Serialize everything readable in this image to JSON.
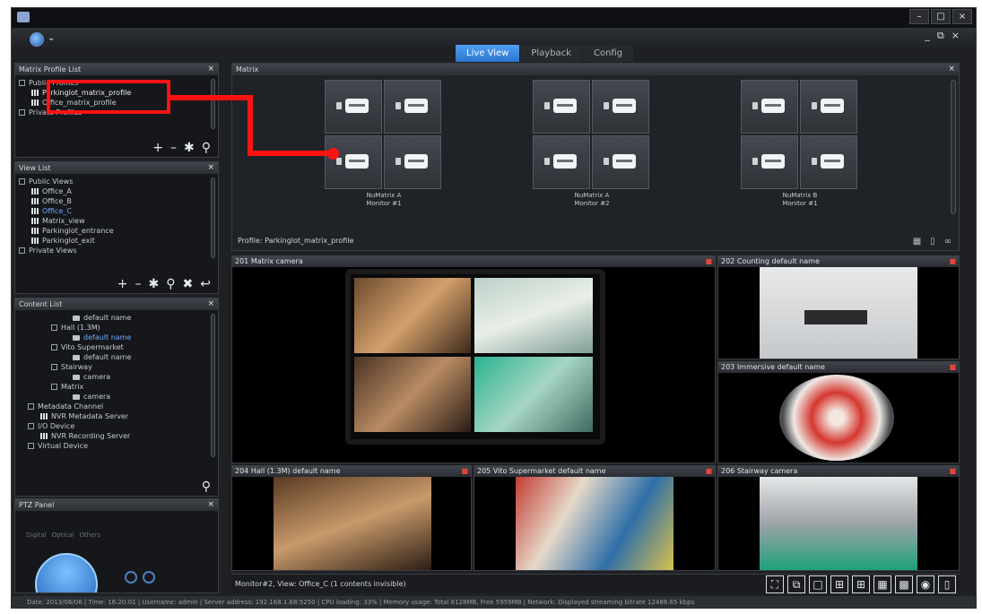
{
  "tabs": [
    {
      "label": "Live View",
      "active": true
    },
    {
      "label": "Playback",
      "active": false
    },
    {
      "label": "Config",
      "active": false
    }
  ],
  "matrix_profile_panel": {
    "title": "Matrix Profile List",
    "items": [
      "Public Profiles",
      "Parkinglot_matrix_profile",
      "Office_matrix_profile",
      "Private Profiles"
    ]
  },
  "view_panel": {
    "title": "View List",
    "items": [
      "Public Views",
      "Office_A",
      "Office_B",
      "Office_C",
      "Matrix_view",
      "Parkinglot_entrance",
      "Parkinglot_exit",
      "Private Views"
    ]
  },
  "content_panel": {
    "title": "Content List",
    "items": [
      "default name",
      "Hall (1.3M)",
      "default name",
      "Vito Supermarket",
      "default name",
      "Stairway",
      "camera",
      "Matrix",
      "camera",
      "Metadata Channel",
      "NVR Metadata Server",
      "I/O Device",
      "NVR Recording Server",
      "Virtual Device"
    ]
  },
  "ptz_panel": {
    "title": "PTZ Panel",
    "tabs": [
      "Digital",
      "Optical",
      "Others"
    ]
  },
  "matrix": {
    "title": "Matrix",
    "groups": [
      {
        "line1": "NuMatrix A",
        "line2": "Monitor #1"
      },
      {
        "line1": "NuMatrix A",
        "line2": "Monitor #2"
      },
      {
        "line1": "NuMatrix B",
        "line2": "Monitor #1"
      }
    ],
    "profile_label": "Profile: Parkinglot_matrix_profile"
  },
  "tiles": [
    {
      "title": "201 Matrix camera"
    },
    {
      "title": "202 Counting default name"
    },
    {
      "title": "203 Immersive default name"
    },
    {
      "title": "204 Hall (1.3M) default name"
    },
    {
      "title": "205 Vito Supermarket default name"
    },
    {
      "title": "206 Stairway camera"
    }
  ],
  "status": {
    "monitor_text": "Monitor#2, View: Office_C (1 contents invisible)",
    "footer": "Date: 2013/06/06 | Time: 16:20:01 | Username: admin | Server address: 192.168.1.68:5250 | CPU loading: 33% | Memory usage: Total 8128MB, Free 5959MB | Network: Displayed streaming bitrate 12486.65 kbps"
  },
  "colors": {
    "highlight": "#ff1212",
    "tab_active": "#3a8ae6",
    "background": "#1e2024"
  },
  "icons": [
    "app-globe-icon",
    "add-icon",
    "remove-icon",
    "settings-icon",
    "search-icon",
    "tools-icon",
    "export-icon",
    "record-indicator-icon",
    "fullscreen-icon",
    "layout-1x1-icon",
    "layout-2x2-icon",
    "layout-3x3-icon",
    "snapshot-icon",
    "trash-icon"
  ]
}
